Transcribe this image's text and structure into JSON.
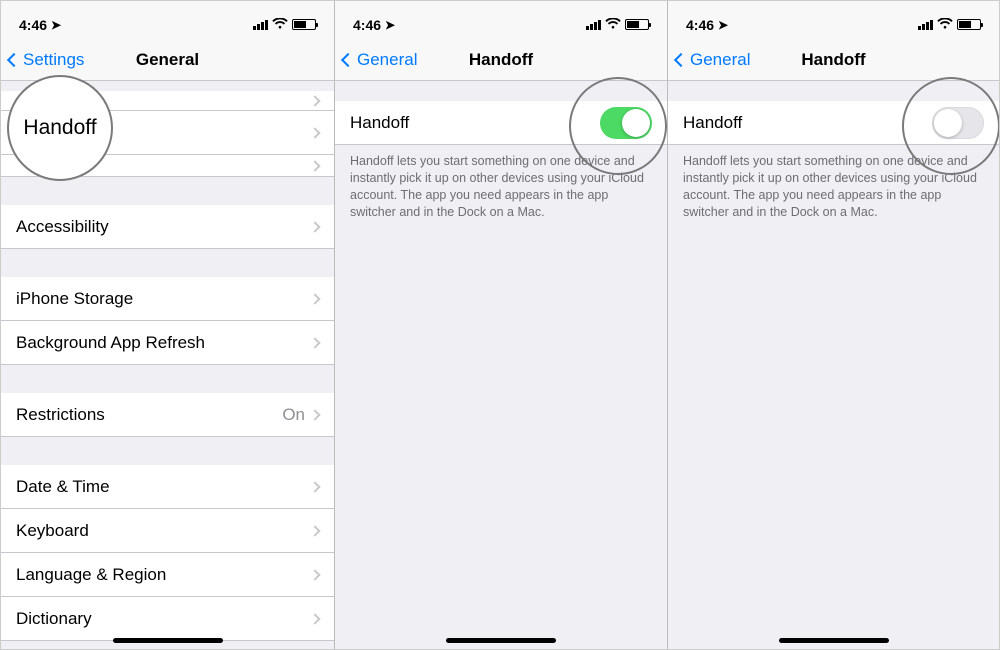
{
  "statusbar": {
    "time": "4:46"
  },
  "phone1": {
    "back_label": "Settings",
    "title": "General",
    "handoff_label": "Handoff",
    "rows": {
      "accessibility": "Accessibility",
      "iphone_storage": "iPhone Storage",
      "background_refresh": "Background App Refresh",
      "restrictions": "Restrictions",
      "restrictions_value": "On",
      "date_time": "Date & Time",
      "keyboard": "Keyboard",
      "language_region": "Language & Region",
      "dictionary": "Dictionary"
    }
  },
  "phone2": {
    "back_label": "General",
    "title": "Handoff",
    "row_label": "Handoff",
    "footer": "Handoff lets you start something on one device and instantly pick it up on other devices using your iCloud account. The app you need appears in the app switcher and in the Dock on a Mac."
  },
  "phone3": {
    "back_label": "General",
    "title": "Handoff",
    "row_label": "Handoff",
    "footer": "Handoff lets you start something on one device and instantly pick it up on other devices using your iCloud account. The app you need appears in the app switcher and in the Dock on a Mac."
  }
}
